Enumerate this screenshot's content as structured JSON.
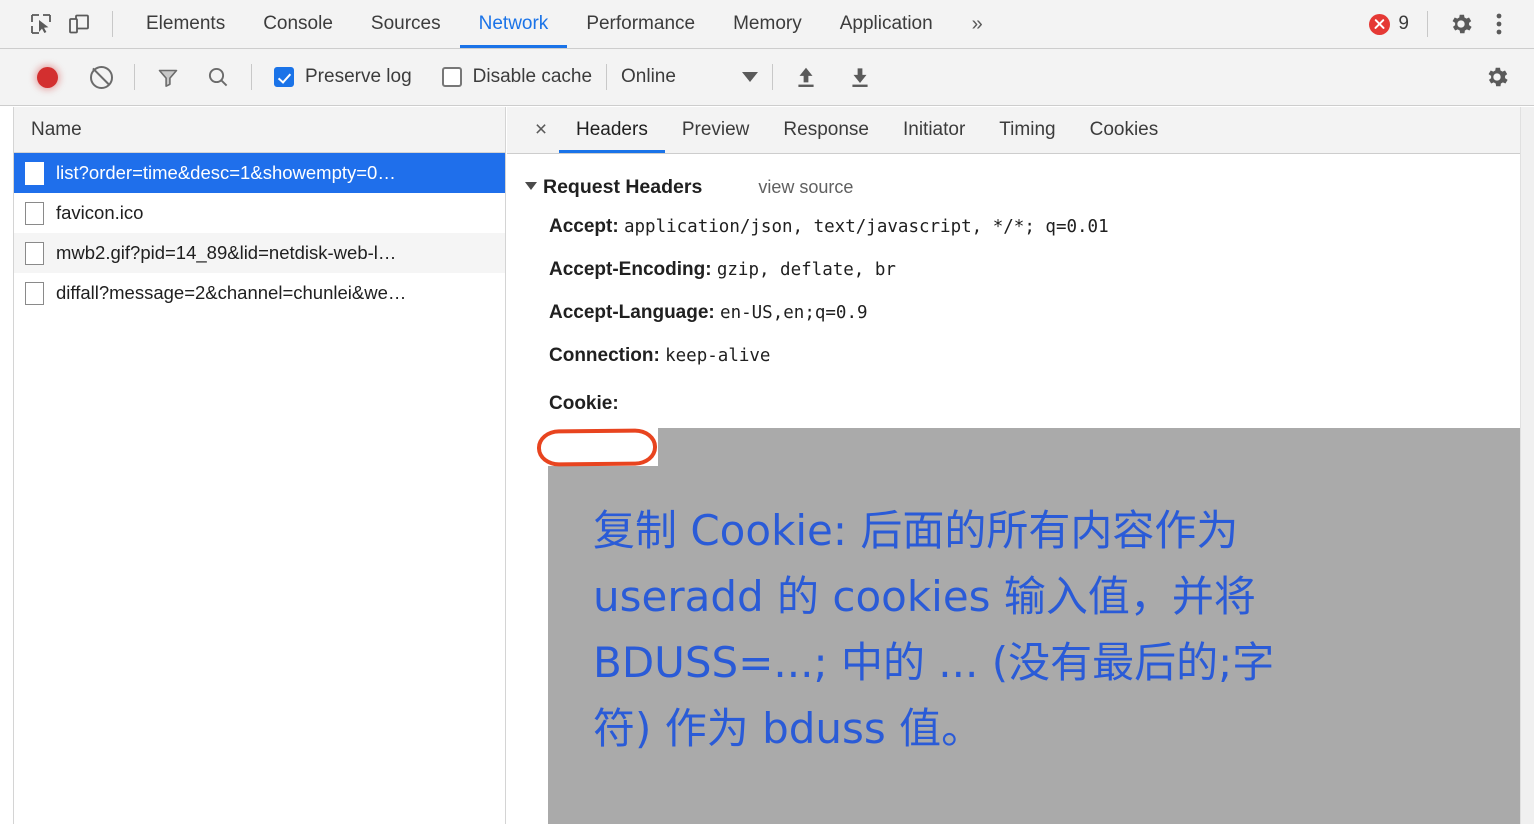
{
  "devtools": {
    "inspect_icon": "inspect-cursor-icon",
    "device_toolbar_icon": "device-toolbar-icon",
    "main_tabs": [
      {
        "label": "Elements",
        "selected": false
      },
      {
        "label": "Console",
        "selected": false
      },
      {
        "label": "Sources",
        "selected": false
      },
      {
        "label": "Network",
        "selected": true
      },
      {
        "label": "Performance",
        "selected": false
      },
      {
        "label": "Memory",
        "selected": false
      },
      {
        "label": "Application",
        "selected": false
      }
    ],
    "more_tabs_label": "»",
    "error_count": "9",
    "settings_icon": "gear-icon",
    "menu_icon": "kebab-menu-icon"
  },
  "network_toolbar": {
    "record_icon": "record-button-icon",
    "clear_icon": "clear-icon",
    "filter_icon": "filter-funnel-icon",
    "search_icon": "search-icon",
    "preserve_log_label": "Preserve log",
    "preserve_log_checked": true,
    "disable_cache_label": "Disable cache",
    "disable_cache_checked": false,
    "throttle_value": "Online",
    "import_icon": "import-har-icon",
    "export_icon": "export-har-icon",
    "settings_icon": "gear-icon"
  },
  "requests": {
    "column_header": "Name",
    "rows": [
      {
        "name": "list?order=time&desc=1&showempty=0…",
        "selected": true
      },
      {
        "name": "favicon.ico",
        "selected": false
      },
      {
        "name": "mwb2.gif?pid=14_89&lid=netdisk-web-l…",
        "selected": false
      },
      {
        "name": "diffall?message=2&channel=chunlei&we…",
        "selected": false
      }
    ]
  },
  "detail": {
    "close_label": "×",
    "tabs": [
      {
        "label": "Headers",
        "selected": true
      },
      {
        "label": "Preview",
        "selected": false
      },
      {
        "label": "Response",
        "selected": false
      },
      {
        "label": "Initiator",
        "selected": false
      },
      {
        "label": "Timing",
        "selected": false
      },
      {
        "label": "Cookies",
        "selected": false
      }
    ],
    "section_title": "Request Headers",
    "view_source_label": "view source",
    "headers": [
      {
        "key": "Accept:",
        "value": "application/json, text/javascript, */*; q=0.01"
      },
      {
        "key": "Accept-Encoding:",
        "value": "gzip, deflate, br"
      },
      {
        "key": "Accept-Language:",
        "value": "en-US,en;q=0.9"
      },
      {
        "key": "Connection:",
        "value": "keep-alive"
      }
    ],
    "cookie_header_key": "Cookie:"
  },
  "annotation": {
    "lines": [
      "复制 Cookie: 后面的所有内容作为",
      "useradd 的 cookies 输入值，并将",
      "BDUSS=...; 中的 ... (没有最后的;字",
      "符) 作为 bduss 值。"
    ],
    "text_color": "#2a5bd7",
    "highlight_color": "#e8441f",
    "redaction_color": "#aaaaaa"
  }
}
